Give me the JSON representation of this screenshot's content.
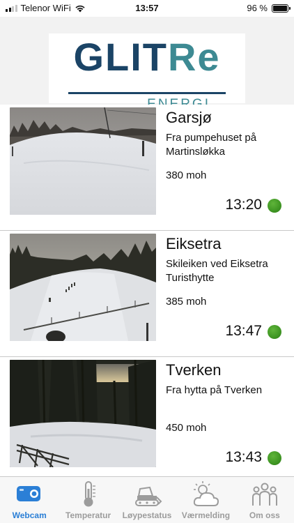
{
  "status_bar": {
    "carrier": "Telenor WiFi",
    "time": "13:57",
    "battery": "96 %",
    "battery_level": 0.96,
    "signal_icon": "cellular-signal-icon",
    "wifi_icon": "wifi-icon",
    "battery_icon": "battery-icon"
  },
  "header": {
    "logo_text_part1": "GLIT",
    "logo_text_part2": "Re",
    "logo_subtext": "ENERGI",
    "colors": {
      "navy": "#1b4466",
      "teal": "#3d8a93"
    }
  },
  "webcams": [
    {
      "name": "Garsjø",
      "description": "Fra pumpehuset på Martinsløkka",
      "altitude": "380 moh",
      "time": "13:20",
      "status_color": "#3f9623"
    },
    {
      "name": "Eiksetra",
      "description": "Skileiken ved Eiksetra Turisthytte",
      "altitude": "385 moh",
      "time": "13:47",
      "status_color": "#3f9623"
    },
    {
      "name": "Tverken",
      "description": "Fra hytta på Tverken",
      "altitude": "450 moh",
      "time": "13:43",
      "status_color": "#3f9623"
    }
  ],
  "tabs": [
    {
      "label": "Webcam",
      "icon": "webcam-icon",
      "active": true
    },
    {
      "label": "Temperatur",
      "icon": "thermometer-icon",
      "active": false
    },
    {
      "label": "Løypestatus",
      "icon": "snowcat-icon",
      "active": false
    },
    {
      "label": "Værmelding",
      "icon": "weather-icon",
      "active": false
    },
    {
      "label": "Om oss",
      "icon": "people-icon",
      "active": false
    }
  ],
  "colors": {
    "accent": "#2b7fd6",
    "inactive": "#9c9c9c",
    "status_ok": "#3f9623"
  }
}
